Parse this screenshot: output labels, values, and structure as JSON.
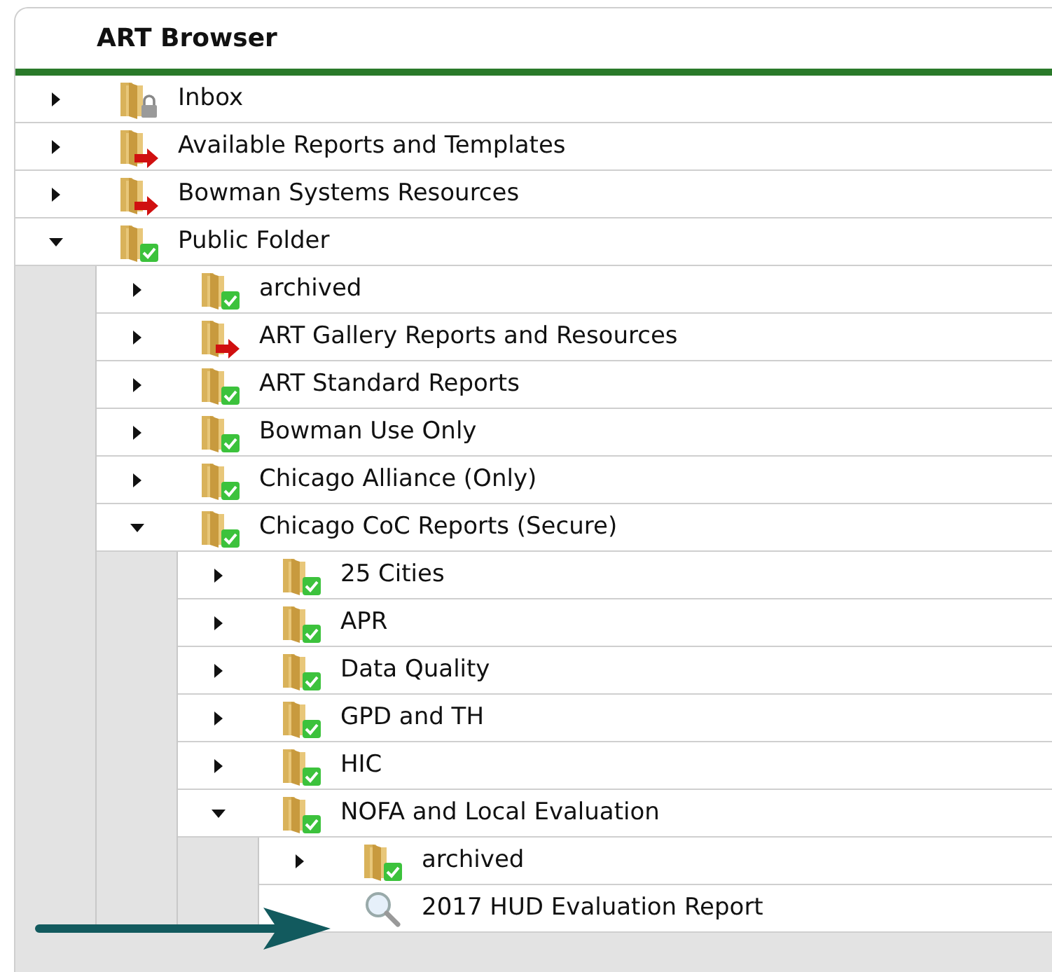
{
  "panel": {
    "title": "ART Browser"
  },
  "tree": [
    {
      "kind": "locked",
      "label": "Inbox",
      "expanded": false
    },
    {
      "kind": "shared",
      "label": "Available Reports and Templates",
      "expanded": false
    },
    {
      "kind": "shared",
      "label": "Bowman Systems Resources",
      "expanded": false
    },
    {
      "kind": "public",
      "label": "Public Folder",
      "expanded": true,
      "children": [
        {
          "kind": "public",
          "label": "archived",
          "expanded": false
        },
        {
          "kind": "shared",
          "label": "ART Gallery Reports and Resources",
          "expanded": false
        },
        {
          "kind": "public",
          "label": "ART Standard Reports",
          "expanded": false
        },
        {
          "kind": "public",
          "label": "Bowman Use Only",
          "expanded": false
        },
        {
          "kind": "public",
          "label": "Chicago Alliance (Only)",
          "expanded": false
        },
        {
          "kind": "public",
          "label": "Chicago CoC Reports (Secure)",
          "expanded": true,
          "children": [
            {
              "kind": "public",
              "label": "25 Cities",
              "expanded": false
            },
            {
              "kind": "public",
              "label": "APR",
              "expanded": false
            },
            {
              "kind": "public",
              "label": "Data Quality",
              "expanded": false
            },
            {
              "kind": "public",
              "label": "GPD and TH",
              "expanded": false
            },
            {
              "kind": "public",
              "label": "HIC",
              "expanded": false
            },
            {
              "kind": "public",
              "label": "NOFA and Local Evaluation",
              "expanded": true,
              "children": [
                {
                  "kind": "public",
                  "label": "archived",
                  "expanded": false
                },
                {
                  "kind": "report",
                  "label": "2017 HUD Evaluation Report"
                }
              ]
            }
          ]
        }
      ]
    }
  ]
}
